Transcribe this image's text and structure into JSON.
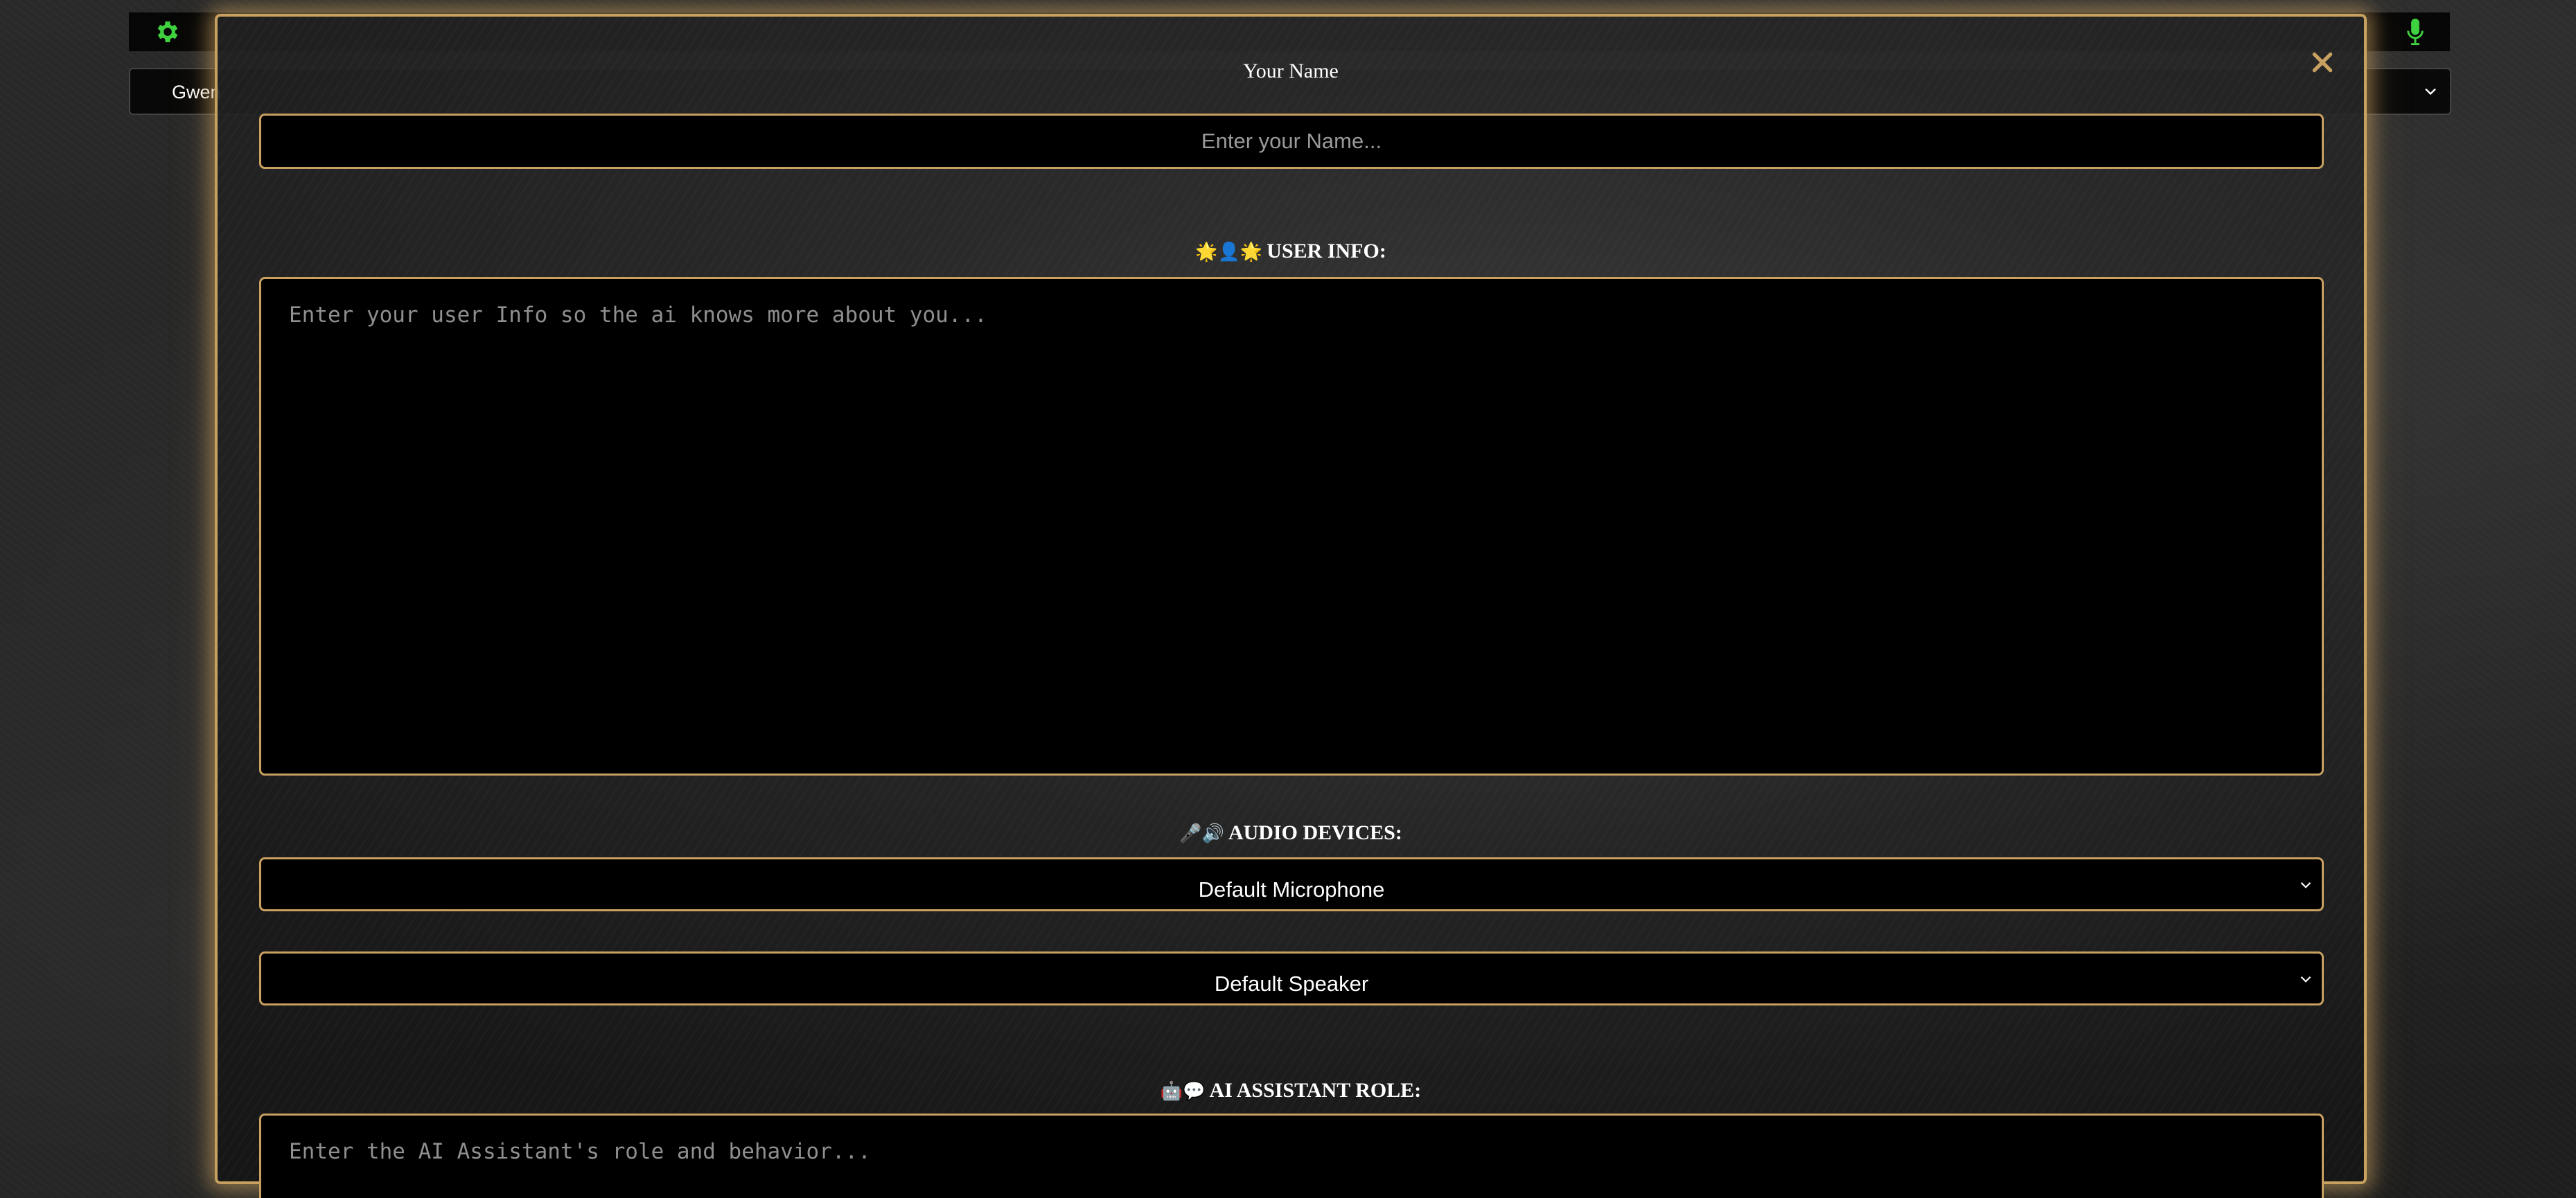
{
  "background": {
    "character_select_value": "Gwen",
    "icons": {
      "settings": "gear-icon",
      "microphone": "microphone-icon",
      "select_chevron": "chevron-down-icon"
    },
    "accent_green": "#3fd13f"
  },
  "modal": {
    "close_icon": "close-icon",
    "accent_color": "#c8a060",
    "name_section": {
      "label": "Your Name",
      "placeholder": "Enter your Name..."
    },
    "user_info_section": {
      "emoji": "🌟👤🌟",
      "label": "USER INFO:",
      "placeholder": "Enter your user Info so the ai knows more about you..."
    },
    "audio_section": {
      "emoji": "🎤🔊",
      "label": "AUDIO DEVICES:",
      "microphone_value": "Default Microphone",
      "speaker_value": "Default Speaker"
    },
    "assistant_section": {
      "emoji": "🤖💬",
      "label": "AI ASSISTANT ROLE:",
      "placeholder": "Enter the AI Assistant's role and behavior..."
    }
  }
}
